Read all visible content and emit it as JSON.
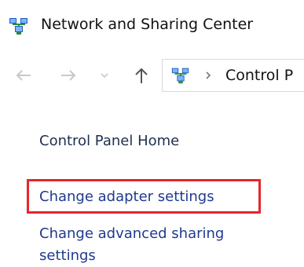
{
  "window": {
    "title": "Network and Sharing Center",
    "icon": "network-icon"
  },
  "navigation": {
    "back_icon": "arrow-left-icon",
    "forward_icon": "arrow-right-icon",
    "recent_icon": "chevron-down-icon",
    "up_icon": "arrow-up-icon"
  },
  "address": {
    "icon": "network-icon",
    "separator_icon": "chevron-right-icon",
    "crumb": "Control P"
  },
  "sidebar": {
    "home_label": "Control Panel Home",
    "adapter_label": "Change adapter settings",
    "advanced_label_line1": "Change advanced sharing",
    "advanced_label_line2": "settings"
  },
  "colors": {
    "link": "#1f3a8f",
    "highlight": "#e5262b",
    "icon_green": "#2e8b3a",
    "icon_blue": "#1f5fbf"
  }
}
